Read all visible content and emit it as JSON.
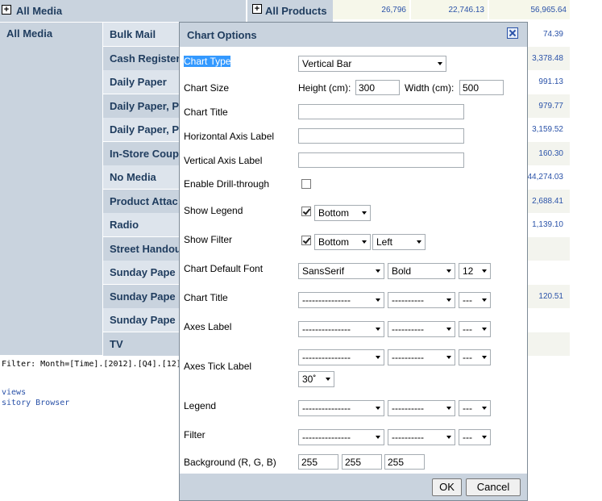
{
  "pivot": {
    "col_header_all": "All Media",
    "col_header_products": "All Products",
    "top_values": [
      "26,796",
      "22,746.13",
      "56,965.64"
    ],
    "row_header": "All Media",
    "categories": [
      "Bulk Mail",
      "Cash Register",
      "Daily Paper",
      "Daily Paper, P",
      "Daily Paper, P",
      "In-Store Coup",
      "No Media",
      "Product Attac",
      "Radio",
      "Street Handou",
      "Sunday Pape",
      "Sunday Pape",
      "Sunday Pape",
      "TV"
    ],
    "right_values": [
      "74.39",
      "3,378.48",
      "991.13",
      "979.77",
      "3,159.52",
      "160.30",
      "44,274.03",
      "2,688.41",
      "1,139.10",
      "",
      "",
      "120.51",
      "",
      ""
    ],
    "filter": "Filter: Month=[Time].[2012].[Q4].[12]",
    "links": [
      "views",
      "sitory Browser"
    ]
  },
  "dialog": {
    "title": "Chart Options",
    "labels": {
      "chart_type": "Chart Type",
      "chart_size": "Chart Size",
      "chart_title": "Chart Title",
      "h_axis": "Horizontal Axis Label",
      "v_axis": "Vertical Axis Label",
      "drill": "Enable Drill-through",
      "legend": "Show Legend",
      "filter": "Show Filter",
      "default_font": "Chart Default Font",
      "chart_title_font": "Chart Title",
      "axes_label": "Axes Label",
      "axes_tick": "Axes Tick Label",
      "legend_font": "Legend",
      "filter_font": "Filter",
      "background": "Background (R, G, B)"
    },
    "chart_type_value": "Vertical Bar",
    "height_label": "Height (cm):",
    "height_value": "300",
    "width_label": "Width (cm):",
    "width_value": "500",
    "legend_pos": "Bottom",
    "filter_pos": "Bottom",
    "filter_align": "Left",
    "font_family": "SansSerif",
    "font_style": "Bold",
    "font_size": "12",
    "dash_family": "---------------",
    "dash_style": "----------",
    "dash_size": "---",
    "tick_rotation": "30˚",
    "bg_r": "255",
    "bg_g": "255",
    "bg_b": "255",
    "ok": "OK",
    "cancel": "Cancel"
  }
}
